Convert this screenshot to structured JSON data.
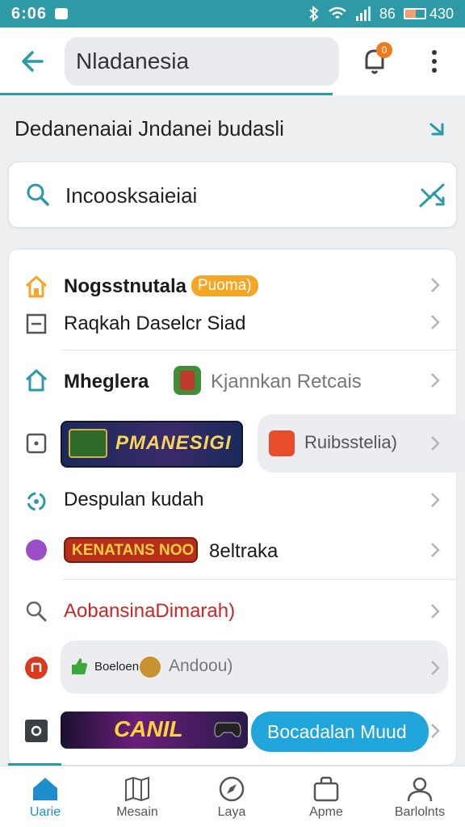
{
  "status": {
    "time": "6:06",
    "signal_text": "86",
    "battery_text": "430"
  },
  "app_bar": {
    "search_value": "Nladanesia",
    "notification_count": "0"
  },
  "section": {
    "title": "Dedanenaiai Jndanei budasli"
  },
  "search": {
    "value": "Incoosksaieiai"
  },
  "list": [
    {
      "label": "Nogsstnutala",
      "badge": "Puoma)"
    },
    {
      "label": "Raqkah Daselcr Siad"
    },
    {
      "label": "Mheglera",
      "secondary": "Kjannkan Retcais"
    },
    {
      "tile_text": "PMANESIGI",
      "secondary": "Ruibsstelia)"
    },
    {
      "label": "Despulan kudah"
    },
    {
      "tile_text": "KENATANS NOO",
      "secondary": "8eltraka"
    },
    {
      "label": "AobansinaDimarah)"
    },
    {
      "small_text": "Boeloen",
      "secondary": "Andoou)"
    },
    {
      "tile_text": "CANIL",
      "button": "Bocadalan Muud"
    }
  ],
  "icons": {
    "status": [
      "bluetooth-icon",
      "wifi-icon",
      "signal-icon",
      "battery-icon"
    ],
    "rows": [
      "home-icon",
      "minus-square-icon",
      "house-outline-icon",
      "square-dot-icon",
      "link-icon",
      "purple-dot-icon",
      "search-icon",
      "red-circle-icon",
      "dark-square-icon"
    ]
  },
  "bottom_nav": [
    {
      "label": "Uarie",
      "icon": "home-icon"
    },
    {
      "label": "Mesain",
      "icon": "map-icon"
    },
    {
      "label": "Laya",
      "icon": "compass-icon"
    },
    {
      "label": "Apme",
      "icon": "bag-icon"
    },
    {
      "label": "Barlolnts",
      "icon": "person-icon"
    }
  ],
  "colors": {
    "accent": "#2e9aa6",
    "nav_active": "#1e8fcb",
    "badge": "#f5a623",
    "cta": "#21a6dc",
    "error_text": "#c62828"
  }
}
